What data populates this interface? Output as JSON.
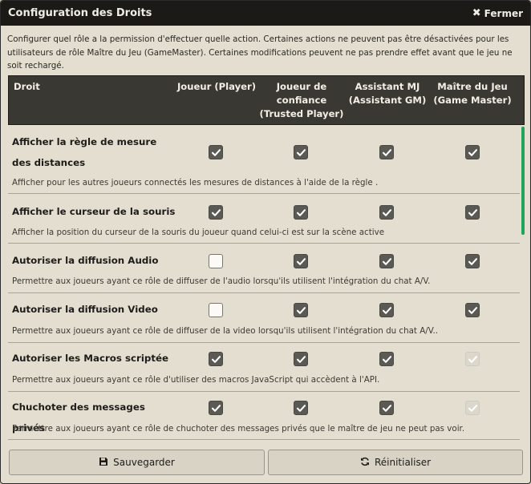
{
  "window": {
    "title": "Configuration des Droits",
    "close_label": "Fermer"
  },
  "intro": "Configurer quel rôle a la permission d'effectuer quelle action. Certaines actions ne peuvent pas être désactivées pour les utilisateurs de rôle Maître du Jeu (GameMaster). Certaines modifications peuvent ne pas prendre effet avant que le jeu ne soit rechargé.",
  "columns": {
    "permission": "Droit",
    "player": [
      "Joueur (Player)"
    ],
    "trusted": [
      "Joueur de",
      "confiance",
      "(Trusted Player)"
    ],
    "assistant": [
      "Assistant MJ",
      "(Assistant GM)"
    ],
    "gm": [
      "Maître du Jeu",
      "(Game Master)"
    ]
  },
  "permissions": [
    {
      "label": "Afficher la règle de mesure des distances",
      "hint": "Afficher pour les autres joueurs connectés les mesures de distances à l'aide de la règle .",
      "states": [
        "checked",
        "checked",
        "checked",
        "checked"
      ]
    },
    {
      "label": "Afficher le curseur de la souris",
      "hint": "Afficher la position du curseur de la souris du joueur quand celui-ci est sur la scène active",
      "states": [
        "checked",
        "checked",
        "checked",
        "checked"
      ]
    },
    {
      "label": "Autoriser la diffusion Audio",
      "hint": "Permettre aux joueurs ayant ce rôle de diffuser de l'audio lorsqu'ils utilisent l'intégration du chat A/V.",
      "states": [
        "unchecked",
        "checked",
        "checked",
        "checked"
      ]
    },
    {
      "label": "Autoriser la diffusion Video",
      "hint": "Permettre aux joueurs ayant ce rôle de diffuser de la video lorsqu'ils utilisent l'intégration du chat A/V..",
      "states": [
        "unchecked",
        "checked",
        "checked",
        "checked"
      ]
    },
    {
      "label": "Autoriser les Macros scriptée",
      "hint": "Permettre aux joueurs ayant ce rôle d'utiliser des macros JavaScript qui accèdent à l'API.",
      "states": [
        "checked",
        "checked",
        "checked",
        "disabled"
      ]
    },
    {
      "label": "Chuchoter des messages privés",
      "hint": "Permettre aux joueurs ayant ce rôle de chuchoter des messages privés que le maître de jeu ne peut pas voir.",
      "states": [
        "checked",
        "checked",
        "checked",
        "disabled"
      ]
    }
  ],
  "footer": {
    "save_label": "Sauvegarder",
    "save_icon": "save-icon",
    "reset_label": "Réinitialiser",
    "reset_icon": "sync-icon"
  },
  "colors": {
    "accent": "#21a35a",
    "header_bg": "#3a3833"
  }
}
